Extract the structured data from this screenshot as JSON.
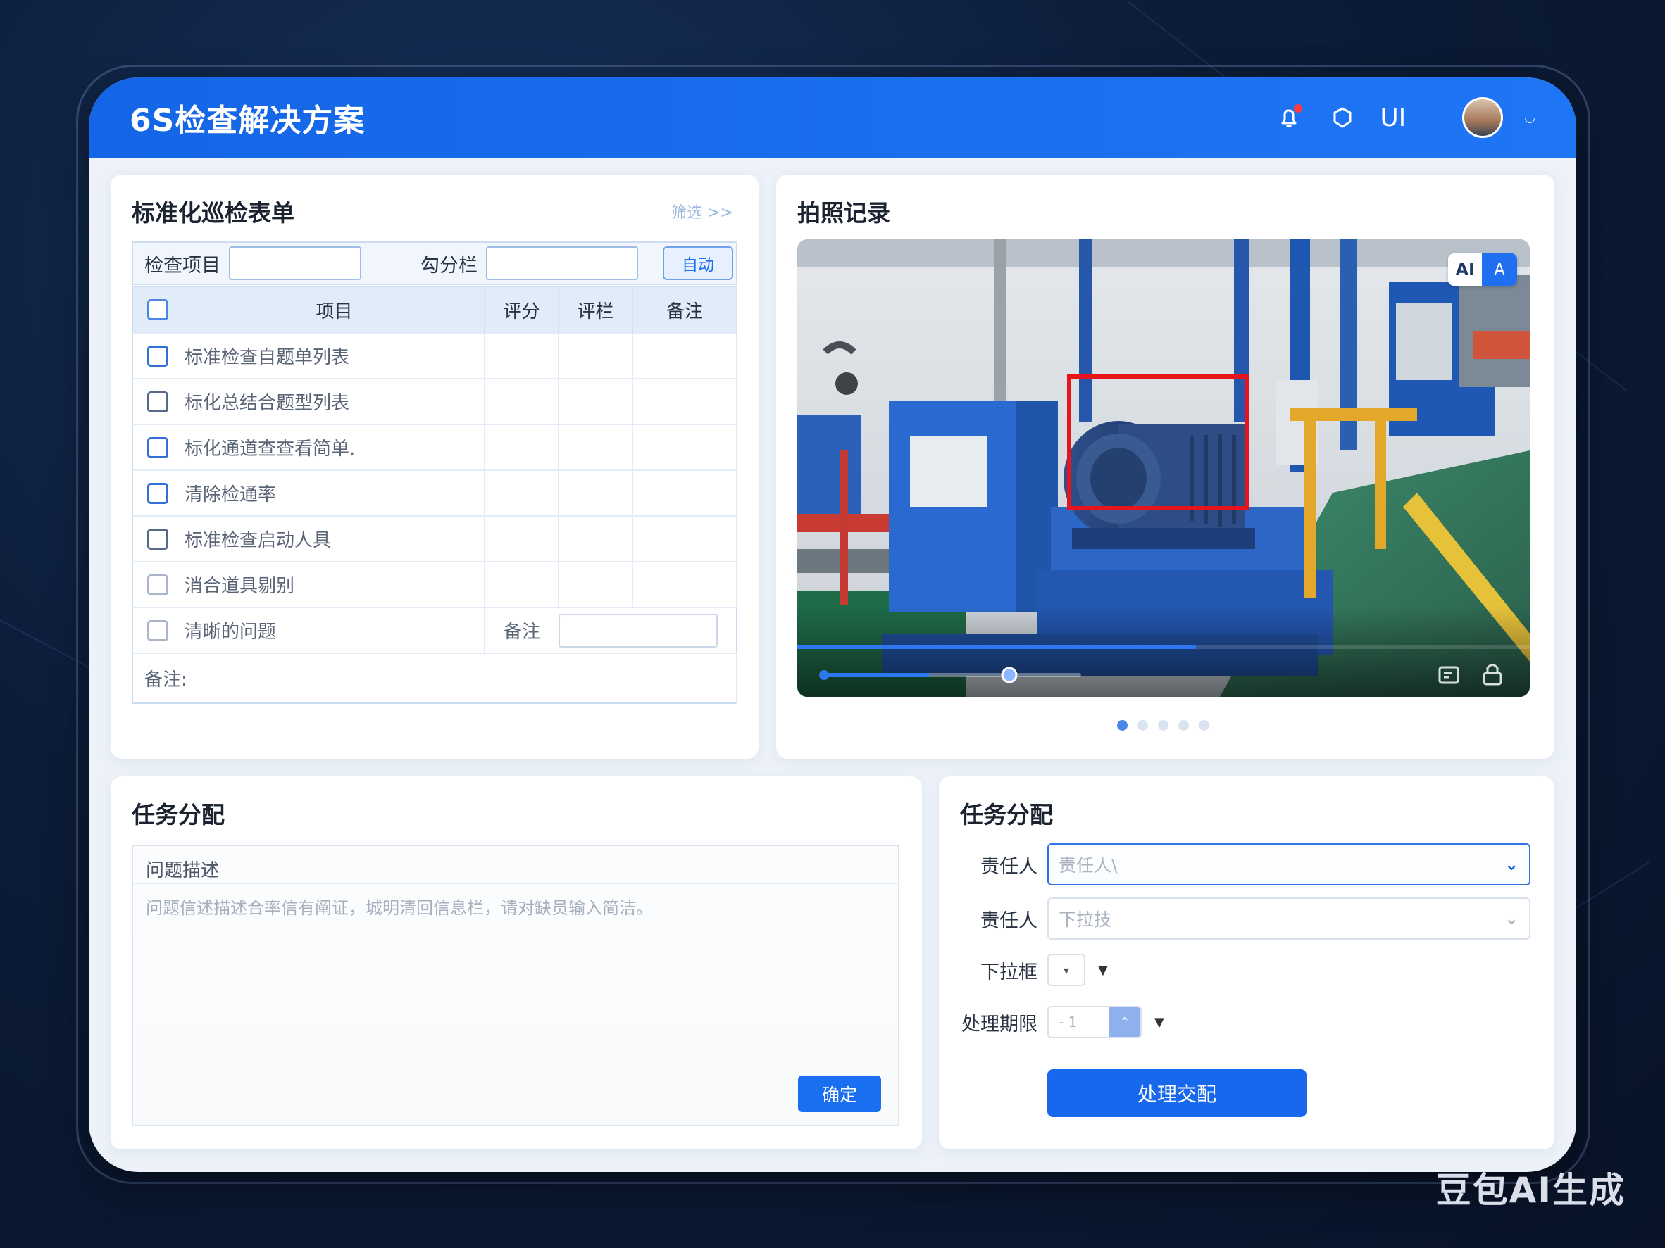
{
  "header": {
    "title": "6S检查解决方案",
    "user_text": "UI"
  },
  "checklist": {
    "title": "标准化巡检表单",
    "link": "筛选 >>",
    "field1_label": "检查项目",
    "field2_label": "勾分栏",
    "auto_btn": "自动",
    "columns": [
      "项目",
      "评分",
      "评栏",
      "备注"
    ],
    "items": [
      "标准检查自题单列表",
      "标化总结合题型列表",
      "标化通道查查看简单.",
      "清除检通率",
      "标准检查启动人具",
      "消合道具剔别"
    ],
    "last_item": "清晰的问题",
    "last_note_label": "备注",
    "remarks_label": "备注:"
  },
  "photo": {
    "title": "拍照记录",
    "ai_badge": "AI",
    "ai_icon": "A",
    "progress": 0.54
  },
  "task_desc": {
    "title": "任务分配",
    "box_title": "问题描述",
    "placeholder": "问题信述描述合率信有阐证，城明清回信息栏，请对缺员输入简洁。",
    "submit": "确定"
  },
  "task_assign": {
    "title": "任务分配",
    "owner_label": "责任人",
    "owner_placeholder": "责任人\\",
    "owner2_label": "责任人",
    "owner2_placeholder": "下拉技",
    "dropdown_label": "下拉框",
    "deadline_label": "处理期限",
    "deadline_value": "- 1",
    "assign_btn": "处理交配"
  },
  "watermark": "豆包AI生成",
  "colors": {
    "primary": "#1a6ff0",
    "alert_dot": "#ff3b3b",
    "detect_box": "#e8141c"
  }
}
